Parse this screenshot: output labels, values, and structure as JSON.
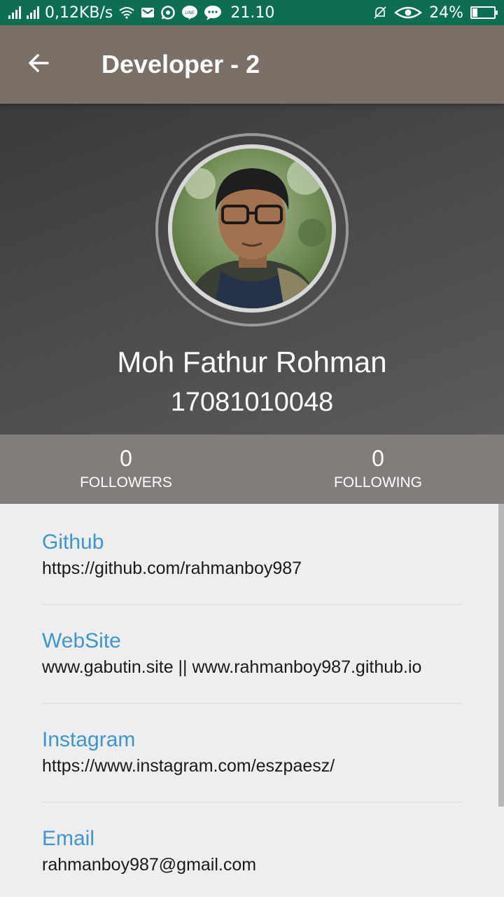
{
  "status_bar": {
    "speed": "0,12KB/s",
    "time": "21.10",
    "battery": "24%",
    "battery_level": 0.24,
    "icons": [
      "signal-icon",
      "signal-icon",
      "wifi-icon",
      "gmail-icon",
      "whatsapp-icon",
      "line-icon",
      "message-icon",
      "mute-icon",
      "eye-icon",
      "battery-icon"
    ]
  },
  "appbar": {
    "title": "Developer - 2",
    "back_icon": "arrow-left-icon"
  },
  "profile": {
    "name": "Moh Fathur Rohman",
    "nim": "17081010048"
  },
  "stats": {
    "followers_count": "0",
    "followers_label": "FOLLOWERS",
    "following_count": "0",
    "following_label": "FOLLOWING"
  },
  "links": [
    {
      "label": "Github",
      "value": "https://github.com/rahmanboy987"
    },
    {
      "label": "WebSite",
      "value": "www.gabutin.site || www.rahmanboy987.github.io"
    },
    {
      "label": "Instagram",
      "value": "https://www.instagram.com/eszpaesz/"
    },
    {
      "label": "Email",
      "value": "rahmanboy987@gmail.com"
    }
  ],
  "colors": {
    "status_bar": "#0d6e52",
    "appbar": "#7a7068",
    "stats_bar": "#817d7b",
    "link_label": "#3d96d0"
  }
}
